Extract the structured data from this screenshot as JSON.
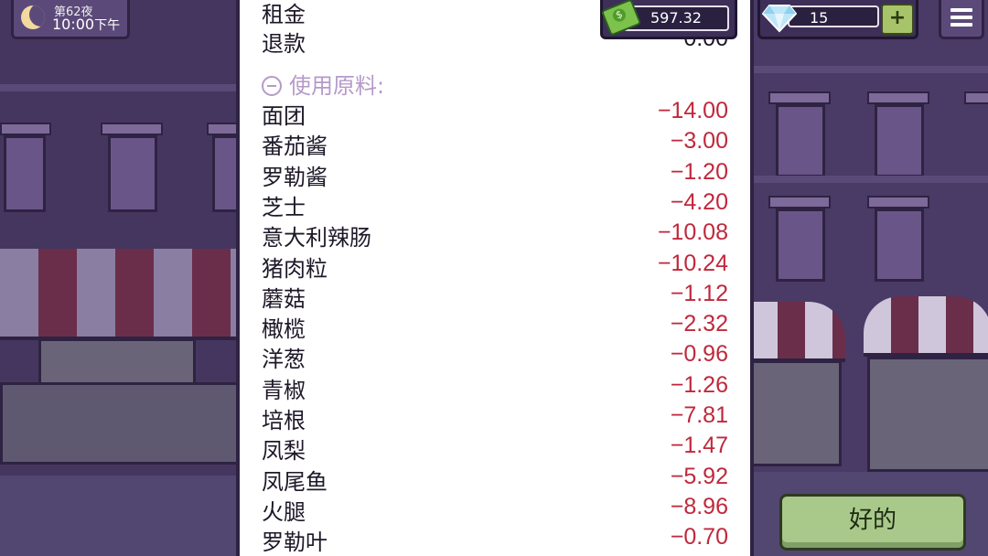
{
  "hud": {
    "night_label": "第62夜",
    "time": "10:00",
    "time_period": "下午",
    "money": "597.32",
    "gems": "15",
    "add_label": "+"
  },
  "receipt": {
    "top_rows": [
      {
        "label": "租金",
        "value": ""
      },
      {
        "label": "退款",
        "value": "0.00"
      }
    ],
    "ingredients_header": "使用原料:",
    "ingredients": [
      {
        "label": "面团",
        "value": "−14.00"
      },
      {
        "label": "番茄酱",
        "value": "−3.00"
      },
      {
        "label": "罗勒酱",
        "value": "−1.20"
      },
      {
        "label": "芝士",
        "value": "−4.20"
      },
      {
        "label": "意大利辣肠",
        "value": "−10.08"
      },
      {
        "label": "猪肉粒",
        "value": "−10.24"
      },
      {
        "label": "蘑菇",
        "value": "−1.12"
      },
      {
        "label": "橄榄",
        "value": "−2.32"
      },
      {
        "label": "洋葱",
        "value": "−0.96"
      },
      {
        "label": "青椒",
        "value": "−1.26"
      },
      {
        "label": "培根",
        "value": "−7.81"
      },
      {
        "label": "凤梨",
        "value": "−1.47"
      },
      {
        "label": "凤尾鱼",
        "value": "−5.92"
      },
      {
        "label": "火腿",
        "value": "−8.96"
      },
      {
        "label": "罗勒叶",
        "value": "−0.70"
      }
    ]
  },
  "ok_button": "好的",
  "colors": {
    "negative": "#c0283c",
    "section_header": "#b59ac9",
    "button": "#a9c98a"
  },
  "icons": [
    "moon-icon",
    "cash-icon",
    "gem-icon",
    "plus-icon",
    "menu-icon",
    "collapse-icon"
  ]
}
